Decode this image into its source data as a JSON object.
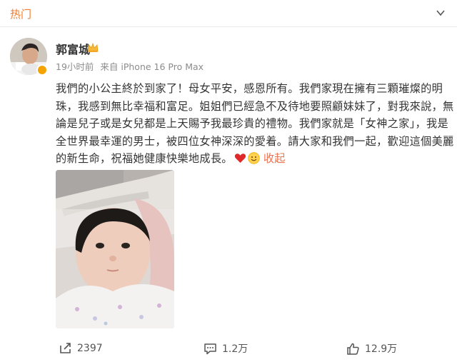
{
  "header": {
    "title": "热门",
    "menu_icon": "chevron-down-icon"
  },
  "post": {
    "author": "郭富城",
    "time": "19小时前",
    "source": "来自 iPhone 16 Pro Max",
    "lines": [
      "我們的小公主終於到家了！母女平安，感恩所有。我們家現在擁有三顆璀燦的明",
      "珠，我感到無比幸福和富足。姐姐們已經急不及待地要照顧妹妹了，對我來說，無",
      "論是兒子或是女兒都是上天賜予我最珍貴的禮物。我們家就是「女神之家」，我是",
      "全世界最幸運的男士，被四位女神深深的愛着。請大家和我們一起，歡迎這個美麗",
      "的新生命，祝福她健康快樂地成長。"
    ],
    "collapse_label": "收起",
    "emojis": [
      "heart-icon",
      "smile-icon"
    ]
  },
  "actions": {
    "share_count": "2397",
    "comment_count": "1.2万",
    "like_count": "12.9万"
  },
  "colors": {
    "accent": "#f37a2b",
    "link": "#eb7350",
    "verified": "#f4a300"
  }
}
